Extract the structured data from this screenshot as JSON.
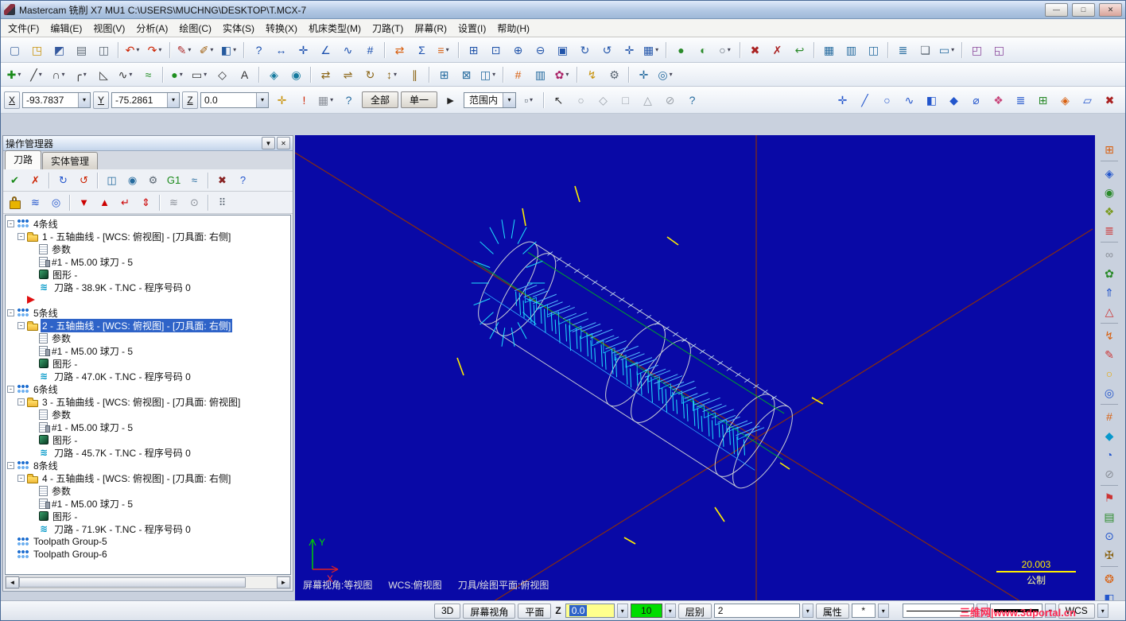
{
  "ui": {
    "dropdown_arrow": "▾",
    "expander": "-",
    "scroll_left": "◄",
    "scroll_right": "►"
  },
  "window": {
    "title": "Mastercam 铣削 X7 MU1  C:\\USERS\\MUCHNG\\DESKTOP\\T.MCX-7",
    "minimize_glyph": "—",
    "maximize_glyph": "□",
    "close_glyph": "✕"
  },
  "menu": [
    {
      "name": "menu-file",
      "label": "文件(F)"
    },
    {
      "name": "menu-edit",
      "label": "编辑(E)"
    },
    {
      "name": "menu-view",
      "label": "视图(V)"
    },
    {
      "name": "menu-analyze",
      "label": "分析(A)"
    },
    {
      "name": "menu-create",
      "label": "绘图(C)"
    },
    {
      "name": "menu-solids",
      "label": "实体(S)"
    },
    {
      "name": "menu-xform",
      "label": "转换(X)"
    },
    {
      "name": "menu-machine-type",
      "label": "机床类型(M)"
    },
    {
      "name": "menu-toolpaths",
      "label": "刀路(T)"
    },
    {
      "name": "menu-screen",
      "label": "屏幕(R)"
    },
    {
      "name": "menu-settings",
      "label": "设置(I)"
    },
    {
      "name": "menu-help",
      "label": "帮助(H)"
    }
  ],
  "toolbar1": [
    {
      "name": "new-file-icon",
      "g": "▢",
      "c": "#4a6fa5"
    },
    {
      "name": "open-file-icon",
      "g": "◳",
      "c": "#c8920a"
    },
    {
      "name": "save-file-icon",
      "g": "◩",
      "c": "#35599e"
    },
    {
      "name": "print-icon",
      "g": "▤",
      "c": "#5a6672"
    },
    {
      "name": "screen-capture-icon",
      "g": "◫",
      "c": "#5a6672"
    },
    {
      "sep": true
    },
    {
      "name": "undo-icon",
      "g": "↶",
      "c": "#cc2200",
      "d": true
    },
    {
      "name": "redo-icon",
      "g": "↷",
      "c": "#cc2200",
      "d": true
    },
    {
      "sep": true
    },
    {
      "name": "attribute-color-icon",
      "g": "✎",
      "c": "#b03030",
      "d": true
    },
    {
      "name": "attribute-style-icon",
      "g": "✐",
      "c": "#a06010",
      "d": true
    },
    {
      "name": "attribute-fill-icon",
      "g": "◧",
      "c": "#255a9e",
      "d": true
    },
    {
      "sep": true
    },
    {
      "name": "analyze-entity-icon",
      "g": "?",
      "c": "#1a4fae"
    },
    {
      "name": "analyze-distance-icon",
      "g": "↔",
      "c": "#1a4fae"
    },
    {
      "name": "analyze-dynamic-icon",
      "g": "✛",
      "c": "#1a4fae"
    },
    {
      "name": "analyze-angle-icon",
      "g": "∠",
      "c": "#1a4fae"
    },
    {
      "name": "analyze-chain-icon",
      "g": "∿",
      "c": "#1a4fae"
    },
    {
      "name": "analyze-stats-icon",
      "g": "#",
      "c": "#1a4fae"
    },
    {
      "sep": true
    },
    {
      "name": "xform-mirror-icon",
      "g": "⇄",
      "c": "#d86010"
    },
    {
      "name": "xform-sum-icon",
      "g": "Σ",
      "c": "#1a4fae"
    },
    {
      "name": "xform-array-icon",
      "g": "≡",
      "c": "#d86010",
      "d": true
    },
    {
      "sep": true
    },
    {
      "name": "zoom-window-icon",
      "g": "⊞",
      "c": "#2255aa"
    },
    {
      "name": "zoom-target-icon",
      "g": "⊡",
      "c": "#2255aa"
    },
    {
      "name": "zoom-in-icon",
      "g": "⊕",
      "c": "#2255aa"
    },
    {
      "name": "zoom-out-icon",
      "g": "⊖",
      "c": "#2255aa"
    },
    {
      "name": "zoom-fit-icon",
      "g": "▣",
      "c": "#2255aa"
    },
    {
      "name": "repaint-icon",
      "g": "↻",
      "c": "#2255aa"
    },
    {
      "name": "dynamic-rotate-icon",
      "g": "↺",
      "c": "#2255aa"
    },
    {
      "name": "pan-icon",
      "g": "✛",
      "c": "#2255aa"
    },
    {
      "name": "named-views-icon",
      "g": "▦",
      "c": "#2255aa",
      "d": true
    },
    {
      "sep": true
    },
    {
      "name": "shade-icon",
      "g": "●",
      "c": "#2a8a2a"
    },
    {
      "name": "translucent-icon",
      "g": "◐",
      "c": "#2a8a2a"
    },
    {
      "name": "wireframe-icon",
      "g": "○",
      "c": "#5a6672",
      "d": true
    },
    {
      "sep": true
    },
    {
      "name": "delete-entity-icon",
      "g": "✖",
      "c": "#aa2222"
    },
    {
      "name": "delete-duplicates-icon",
      "g": "✗",
      "c": "#aa2222"
    },
    {
      "name": "undelete-icon",
      "g": "↩",
      "c": "#2a8a2a"
    },
    {
      "sep": true
    },
    {
      "name": "grid-settings-icon",
      "g": "▦",
      "c": "#246a9e"
    },
    {
      "name": "ortho-grid-icon",
      "g": "▥",
      "c": "#246a9e"
    },
    {
      "name": "multi-view-icon",
      "g": "◫",
      "c": "#246a9e"
    },
    {
      "sep": true
    },
    {
      "name": "levels-icon",
      "g": "≣",
      "c": "#246a9e"
    },
    {
      "name": "viewsheets-icon",
      "g": "❏",
      "c": "#5a6672"
    },
    {
      "name": "display-options-icon",
      "g": "▭",
      "c": "#246a9e",
      "d": true
    },
    {
      "sep": true
    },
    {
      "name": "gview-cube-icon",
      "g": "◰",
      "c": "#884499"
    },
    {
      "name": "wcs-cube-icon",
      "g": "◱",
      "c": "#884499"
    }
  ],
  "toolbar2": [
    {
      "name": "create-point-icon",
      "g": "✚",
      "c": "#1a8a1a",
      "d": true
    },
    {
      "name": "create-line-icon",
      "g": "╱",
      "c": "#333333",
      "d": true
    },
    {
      "name": "create-arc-icon",
      "g": "∩",
      "c": "#333333",
      "d": true
    },
    {
      "name": "create-fillet-icon",
      "g": "╭",
      "c": "#333333",
      "d": true
    },
    {
      "name": "create-chamfer-icon",
      "g": "◺",
      "c": "#333333"
    },
    {
      "name": "create-spline-icon",
      "g": "∿",
      "c": "#333333",
      "d": true
    },
    {
      "name": "create-curve-icon",
      "g": "≈",
      "c": "#1a8a1a"
    },
    {
      "sep": true
    },
    {
      "name": "create-surface-icon",
      "g": "●",
      "c": "#1f8f1f",
      "d": true
    },
    {
      "name": "create-rect-icon",
      "g": "▭",
      "c": "#333333",
      "d": true
    },
    {
      "name": "create-polygon-icon",
      "g": "◇",
      "c": "#333333"
    },
    {
      "name": "create-text-icon",
      "g": "A",
      "c": "#333333"
    },
    {
      "sep": true
    },
    {
      "name": "solids-extrude-icon",
      "g": "◈",
      "c": "#147a9e"
    },
    {
      "name": "solids-revolve-icon",
      "g": "◉",
      "c": "#147a9e"
    },
    {
      "sep": true
    },
    {
      "name": "xform-translate-icon",
      "g": "⇄",
      "c": "#8a6414"
    },
    {
      "name": "xform-mirror2-icon",
      "g": "⇌",
      "c": "#8a6414"
    },
    {
      "name": "xform-rotate-icon",
      "g": "↻",
      "c": "#8a6414"
    },
    {
      "name": "xform-scale-icon",
      "g": "↕",
      "c": "#8a6414",
      "d": true
    },
    {
      "name": "xform-offset-icon",
      "g": "∥",
      "c": "#8a6414"
    },
    {
      "sep": true
    },
    {
      "name": "machine-sim-icon",
      "g": "⊞",
      "c": "#246a9e"
    },
    {
      "name": "stock-setup-icon",
      "g": "⊠",
      "c": "#246a9e"
    },
    {
      "name": "tool-manager-icon",
      "g": "◫",
      "c": "#246a9e",
      "d": true
    },
    {
      "sep": true
    },
    {
      "name": "chook-icon",
      "g": "#",
      "c": "#d86010"
    },
    {
      "name": "nesting-icon",
      "g": "▥",
      "c": "#246a9e"
    },
    {
      "name": "art-icon",
      "g": "✿",
      "c": "#aa2266",
      "d": true
    },
    {
      "sep": true
    },
    {
      "name": "run-addin-icon",
      "g": "↯",
      "c": "#c8920a"
    },
    {
      "name": "settings2-icon",
      "g": "⚙",
      "c": "#5a6672"
    },
    {
      "sep": true
    },
    {
      "name": "grid-snap-icon",
      "g": "✛",
      "c": "#246a9e"
    },
    {
      "name": "autocursor-icon",
      "g": "◎",
      "c": "#246a9e",
      "d": true
    }
  ],
  "coordbar": {
    "x_label": "X",
    "x_value": "-93.7837",
    "y_label": "Y",
    "y_value": "-75.2861",
    "z_label": "Z",
    "z_value": "0.0",
    "btn_all": "全部",
    "btn_single": "单一",
    "dd_range": "范围内",
    "icons_a": [
      {
        "name": "fastpoint-icon",
        "g": "✛",
        "c": "#c8920a"
      },
      {
        "name": "cursor-override-icon",
        "g": "!",
        "c": "#cc2200"
      },
      {
        "name": "grid-toggle-icon",
        "g": "▦",
        "c": "#8a8f98",
        "d": true
      },
      {
        "name": "autocursor-help-icon",
        "g": "?",
        "c": "#246a9e"
      }
    ],
    "icons_b": [
      {
        "name": "select-last-icon",
        "g": "►",
        "c": "#222222"
      }
    ],
    "icons_c": [
      {
        "name": "inside-select-icon",
        "g": "▫",
        "c": "#5a6672",
        "d": true
      },
      {
        "sep": true
      },
      {
        "name": "select-cursor-icon",
        "g": "↖",
        "c": "#333333"
      },
      {
        "name": "select-vertex-icon",
        "g": "○",
        "c": "#9aa0a8"
      },
      {
        "name": "select-edge-icon",
        "g": "◇",
        "c": "#9aa0a8"
      },
      {
        "name": "select-face-icon",
        "g": "□",
        "c": "#9aa0a8"
      },
      {
        "name": "select-body-icon",
        "g": "△",
        "c": "#9aa0a8"
      },
      {
        "name": "select-null-icon",
        "g": "⊘",
        "c": "#9aa0a8"
      },
      {
        "name": "select-help-icon",
        "g": "?",
        "c": "#246a9e"
      }
    ],
    "icons_d": [
      {
        "name": "qm-all-points-icon",
        "g": "✛",
        "c": "#2255cc"
      },
      {
        "name": "qm-all-lines-icon",
        "g": "╱",
        "c": "#2255cc"
      },
      {
        "name": "qm-all-arcs-icon",
        "g": "○",
        "c": "#2255cc"
      },
      {
        "name": "qm-all-splines-icon",
        "g": "∿",
        "c": "#2255cc"
      },
      {
        "name": "qm-all-surfaces-icon",
        "g": "◧",
        "c": "#2255cc"
      },
      {
        "name": "qm-all-solids-icon",
        "g": "◆",
        "c": "#2255cc"
      },
      {
        "name": "qm-all-drafting-icon",
        "g": "⌀",
        "c": "#2255cc"
      },
      {
        "name": "qm-color-mask-icon",
        "g": "❖",
        "c": "#c8457a"
      },
      {
        "name": "qm-level-mask-icon",
        "g": "≣",
        "c": "#2255cc"
      },
      {
        "name": "qm-group-mask-icon",
        "g": "⊞",
        "c": "#2a8a2a"
      },
      {
        "name": "qm-result-mask-icon",
        "g": "◈",
        "c": "#d86010"
      },
      {
        "name": "qm-plane-mask-icon",
        "g": "▱",
        "c": "#2255cc"
      },
      {
        "name": "qm-clear-mask-icon",
        "g": "✖",
        "c": "#aa2222"
      }
    ]
  },
  "opman": {
    "title": "操作管理器",
    "collapse_glyph": "▼",
    "close_glyph": "✕",
    "tabs": [
      {
        "name": "tab-toolpaths",
        "label": "刀路",
        "sel": true
      },
      {
        "name": "tab-solids",
        "label": "实体管理"
      }
    ],
    "toolbar_a": [
      {
        "name": "select-all-ops-icon",
        "g": "✔",
        "c": "#1a8a1a"
      },
      {
        "name": "select-all-dirty-ops-icon",
        "g": "✗",
        "c": "#cc2200"
      },
      {
        "sep": true
      },
      {
        "name": "regen-selected-icon",
        "g": "↻",
        "c": "#2255cc"
      },
      {
        "name": "regen-all-icon",
        "g": "↺",
        "c": "#cc2200"
      },
      {
        "sep": true
      },
      {
        "name": "backplot-icon",
        "g": "◫",
        "c": "#246a9e"
      },
      {
        "name": "verify-icon",
        "g": "◉",
        "c": "#246a9e"
      },
      {
        "name": "sim-options-icon",
        "g": "⚙",
        "c": "#5a6672"
      },
      {
        "name": "post-g1-icon",
        "g": "G1",
        "c": "#1a8a1a"
      },
      {
        "name": "highspeed-icon",
        "g": "≈",
        "c": "#246a9e"
      },
      {
        "sep": true
      },
      {
        "name": "delete-ops-icon",
        "g": "✖",
        "c": "#882222"
      },
      {
        "name": "opman-help-icon",
        "g": "?",
        "c": "#2255cc"
      }
    ],
    "toolbar_b": [
      {
        "name": "lock-toolpath-icon",
        "g": "",
        "c": ""
      },
      {
        "name": "toggle-toolpath-display-icon",
        "g": "≋",
        "c": "#2255cc"
      },
      {
        "name": "toggle-rapid-display-icon",
        "g": "◎",
        "c": "#2255cc"
      },
      {
        "sep": true
      },
      {
        "name": "insert-arrow-down-icon",
        "g": "▼",
        "c": "#cc0000"
      },
      {
        "name": "insert-arrow-up-icon",
        "g": "▲",
        "c": "#cc0000"
      },
      {
        "name": "insert-return-icon",
        "g": "↵",
        "c": "#cc0000"
      },
      {
        "name": "insert-toggle-icon",
        "g": "⇕",
        "c": "#cc0000"
      },
      {
        "sep": true
      },
      {
        "name": "display-selected-only-icon",
        "g": "≋",
        "c": "#8a8f98"
      },
      {
        "name": "display-associated-icon",
        "g": "⊙",
        "c": "#8a8f98"
      },
      {
        "sep": true
      },
      {
        "name": "opman-options-icon",
        "g": "⠿",
        "c": "#5a6672"
      }
    ],
    "tree": [
      {
        "type": "group",
        "lvl": 0,
        "x": true,
        "name": "toolpath-group-row",
        "label": "4条线"
      },
      {
        "type": "op",
        "lvl": 1,
        "x": true,
        "name": "operation-row",
        "label": "1 - 五轴曲线 - [WCS: 俯视图] - [刀具面: 右侧]"
      },
      {
        "type": "param",
        "lvl": 2,
        "name": "op-parameters-row",
        "label": "参数"
      },
      {
        "type": "tool",
        "lvl": 2,
        "name": "op-tool-row",
        "label": "#1 - M5.00 球刀 - 5"
      },
      {
        "type": "geom",
        "lvl": 2,
        "name": "op-geometry-row",
        "label": "图形 -"
      },
      {
        "type": "path",
        "lvl": 2,
        "g": "≋",
        "c": "#0098c8",
        "name": "op-toolpath-row",
        "label": "刀路 - 38.9K - T.NC - 程序号码 0"
      },
      {
        "type": "marker",
        "lvl": 1,
        "name": "insert-position-marker",
        "label": ""
      },
      {
        "type": "group",
        "lvl": 0,
        "x": true,
        "name": "toolpath-group-row",
        "label": "5条线"
      },
      {
        "type": "op",
        "lvl": 1,
        "x": true,
        "sel": true,
        "name": "operation-row-selected",
        "label": "2 - 五轴曲线 - [WCS: 俯视图] - [刀具面: 右侧]"
      },
      {
        "type": "param",
        "lvl": 2,
        "name": "op-parameters-row",
        "label": "参数"
      },
      {
        "type": "tool",
        "lvl": 2,
        "name": "op-tool-row",
        "label": "#1 - M5.00 球刀 - 5"
      },
      {
        "type": "geom",
        "lvl": 2,
        "name": "op-geometry-row",
        "label": "图形 -"
      },
      {
        "type": "path",
        "lvl": 2,
        "g": "≋",
        "c": "#0098c8",
        "name": "op-toolpath-row",
        "label": "刀路 - 47.0K - T.NC - 程序号码 0"
      },
      {
        "type": "group",
        "lvl": 0,
        "x": true,
        "name": "toolpath-group-row",
        "label": "6条线"
      },
      {
        "type": "op",
        "lvl": 1,
        "x": true,
        "name": "operation-row",
        "label": "3 - 五轴曲线 - [WCS: 俯视图] - [刀具面: 俯视图]"
      },
      {
        "type": "param",
        "lvl": 2,
        "name": "op-parameters-row",
        "label": "参数"
      },
      {
        "type": "tool",
        "lvl": 2,
        "name": "op-tool-row",
        "label": "#1 - M5.00 球刀 - 5"
      },
      {
        "type": "geom",
        "lvl": 2,
        "name": "op-geometry-row",
        "label": "图形 -"
      },
      {
        "type": "path",
        "lvl": 2,
        "g": "≋",
        "c": "#0098c8",
        "name": "op-toolpath-row",
        "label": "刀路 - 45.7K - T.NC - 程序号码 0"
      },
      {
        "type": "group",
        "lvl": 0,
        "x": true,
        "name": "toolpath-group-row",
        "label": "8条线"
      },
      {
        "type": "op",
        "lvl": 1,
        "x": true,
        "name": "operation-row",
        "label": "4 - 五轴曲线 - [WCS: 俯视图] - [刀具面: 右侧]"
      },
      {
        "type": "param",
        "lvl": 2,
        "name": "op-parameters-row",
        "label": "参数"
      },
      {
        "type": "tool",
        "lvl": 2,
        "name": "op-tool-row",
        "label": "#1 - M5.00 球刀 - 5"
      },
      {
        "type": "geom",
        "lvl": 2,
        "name": "op-geometry-row",
        "label": "图形 -"
      },
      {
        "type": "path",
        "lvl": 2,
        "g": "≋",
        "c": "#0098c8",
        "name": "op-toolpath-row",
        "label": "刀路 - 71.9K - T.NC - 程序号码 0"
      },
      {
        "type": "groupempty",
        "lvl": 0,
        "name": "toolpath-group-row",
        "label": "Toolpath Group-5"
      },
      {
        "type": "groupempty",
        "lvl": 0,
        "name": "toolpath-group-row",
        "label": "Toolpath Group-6"
      }
    ]
  },
  "viewport": {
    "status_view": "屏幕视角:等视图",
    "status_wcs": "WCS:俯视图",
    "status_plane": "刀具/绘图平面:俯视图",
    "scale_value": "20.003",
    "units": "公制",
    "axis_x": "X",
    "axis_y": "Y"
  },
  "right_toolbar": [
    {
      "name": "mr-machine-group-icon",
      "g": "⊞",
      "c": "#d86010"
    },
    {
      "sep": true
    },
    {
      "name": "mr-gview-iso-icon",
      "g": "◈",
      "c": "#2255cc"
    },
    {
      "name": "mr-gview-top-icon",
      "g": "◉",
      "c": "#2a8a2a"
    },
    {
      "name": "mr-gview-front-icon",
      "g": "❖",
      "c": "#7a9a20"
    },
    {
      "name": "mr-gview-side-icon",
      "g": "≣",
      "c": "#cc3333"
    },
    {
      "sep": true
    },
    {
      "name": "mr-link-icon",
      "g": "∞",
      "c": "#8a8f98"
    },
    {
      "name": "mr-flower-icon",
      "g": "✿",
      "c": "#2a8a2a"
    },
    {
      "name": "mr-arrow-up-icon",
      "g": "⇑",
      "c": "#2255cc"
    },
    {
      "name": "mr-triangle-icon",
      "g": "△",
      "c": "#cc3333"
    },
    {
      "sep": true
    },
    {
      "name": "mr-bolt-icon",
      "g": "↯",
      "c": "#d86010"
    },
    {
      "name": "mr-pencil-icon",
      "g": "✎",
      "c": "#cc3333"
    },
    {
      "name": "mr-circle-icon",
      "g": "○",
      "c": "#e8a800"
    },
    {
      "name": "mr-target-icon",
      "g": "◎",
      "c": "#2255cc"
    },
    {
      "sep": true
    },
    {
      "name": "mr-hash-icon",
      "g": "#",
      "c": "#d86010"
    },
    {
      "name": "mr-gem-icon",
      "g": "◆",
      "c": "#0898cc"
    },
    {
      "name": "mr-pie-icon",
      "g": "◔",
      "c": "#2255cc"
    },
    {
      "name": "mr-null-icon",
      "g": "⊘",
      "c": "#8a8f98"
    },
    {
      "sep": true
    },
    {
      "name": "mr-flag-icon",
      "g": "⚑",
      "c": "#cc3333"
    },
    {
      "name": "mr-doc-icon",
      "g": "▤",
      "c": "#2a8a2a"
    },
    {
      "name": "mr-dot-icon",
      "g": "⊙",
      "c": "#2255cc"
    },
    {
      "name": "mr-cross-icon",
      "g": "✠",
      "c": "#8a6414"
    },
    {
      "sep": true
    },
    {
      "name": "mr-sun-icon",
      "g": "❂",
      "c": "#d86010"
    },
    {
      "name": "mr-half-icon",
      "g": "◧",
      "c": "#2255cc"
    },
    {
      "name": "mr-help-icon",
      "g": "?",
      "c": "#2255cc"
    }
  ],
  "statusbar": {
    "btn_3d": "3D",
    "btn_view": "屏幕视角",
    "btn_plane": "平面",
    "z_label": "Z",
    "z_value": "0.0",
    "color_value": "10",
    "level_label": "层别",
    "level_value": "2",
    "btn_attr": "属性",
    "point_style": "*",
    "wcs": "WCS",
    "watermark": "三维网|www.3dportal.cn"
  }
}
